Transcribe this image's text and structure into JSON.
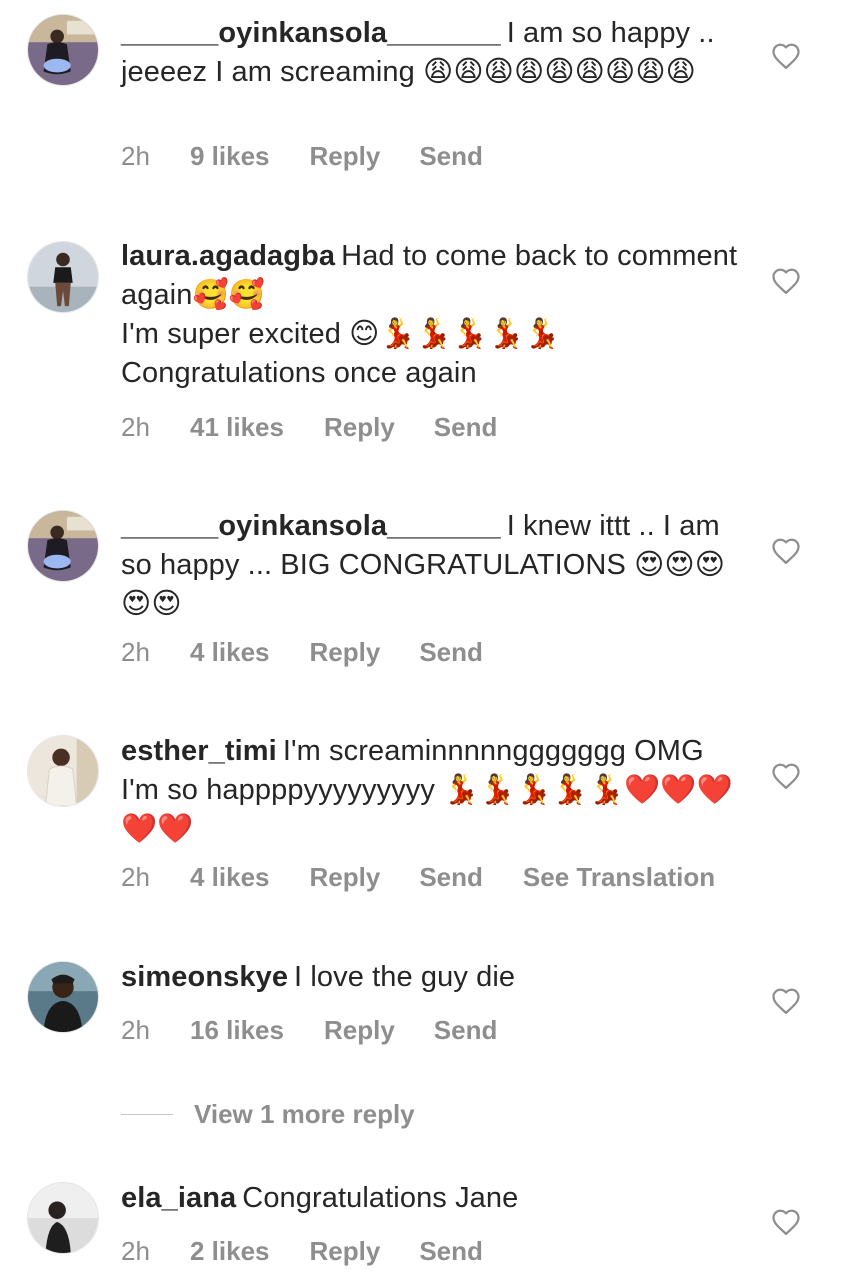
{
  "comments": [
    {
      "username": "______oyinkansola_______",
      "text": "I am so happy .. jeeeez I am screaming 😩😩😩😩😩😩😩😩😩",
      "time": "2h",
      "likes": "9 likes",
      "reply": "Reply",
      "send": "Send"
    },
    {
      "username": "laura.agadagba",
      "text": "Had to come back to comment again🥰🥰\nI'm super excited 😊💃💃💃💃💃\nCongratulations once again",
      "time": "2h",
      "likes": "41 likes",
      "reply": "Reply",
      "send": "Send"
    },
    {
      "username": "______oyinkansola_______",
      "text": "I knew ittt .. I am so happy ... BIG CONGRATULATIONS 😍😍😍😍😍",
      "time": "2h",
      "likes": "4 likes",
      "reply": "Reply",
      "send": "Send"
    },
    {
      "username": "esther_timi",
      "text": "I'm screaminnnnnggggggg OMG I'm so happppyyyyyyyyy 💃💃💃💃💃❤️❤️❤️❤️❤️",
      "time": "2h",
      "likes": "4 likes",
      "reply": "Reply",
      "send": "Send",
      "translate": "See Translation"
    },
    {
      "username": "simeonskye",
      "text": "I love the guy die",
      "time": "2h",
      "likes": "16 likes",
      "reply": "Reply",
      "send": "Send"
    },
    {
      "username": "ela_iana",
      "text": "Congratulations Jane",
      "time": "2h",
      "likes": "2 likes",
      "reply": "Reply",
      "send": "Send"
    }
  ],
  "view_more": "View 1 more reply",
  "icons": {
    "like": "heart-outline-icon"
  },
  "colors": {
    "text": "#262626",
    "meta": "#8e8e8e"
  }
}
